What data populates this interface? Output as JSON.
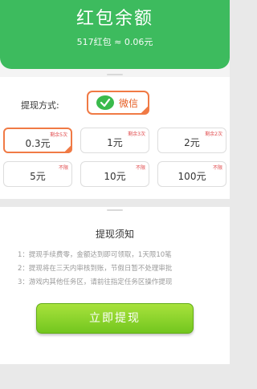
{
  "header": {
    "title": "红包余额",
    "subtitle": "517红包 ≈ 0.06元"
  },
  "withdraw": {
    "method_label": "提现方式:",
    "method_name": "微信",
    "amounts": [
      {
        "value": "0.3元",
        "tag": "剩余5次",
        "selected": true
      },
      {
        "value": "1元",
        "tag": "剩余3次",
        "selected": false
      },
      {
        "value": "2元",
        "tag": "剩余2次",
        "selected": false
      },
      {
        "value": "5元",
        "tag": "不限",
        "selected": false
      },
      {
        "value": "10元",
        "tag": "不限",
        "selected": false
      },
      {
        "value": "100元",
        "tag": "不限",
        "selected": false
      }
    ]
  },
  "notice": {
    "title": "提现须知",
    "items": [
      "1：提现手续费零，金额达到即可领取，1天限10笔",
      "2：提现将在三天内审核到账，节假日暂不处理审批",
      "3：游戏内其他任务区，请前往指定任务区操作提现"
    ]
  },
  "cta_label": "立即提现",
  "colors": {
    "brand_green": "#3dbb5e",
    "accent_orange": "#f07a45",
    "button_green": "#7ccb24"
  }
}
